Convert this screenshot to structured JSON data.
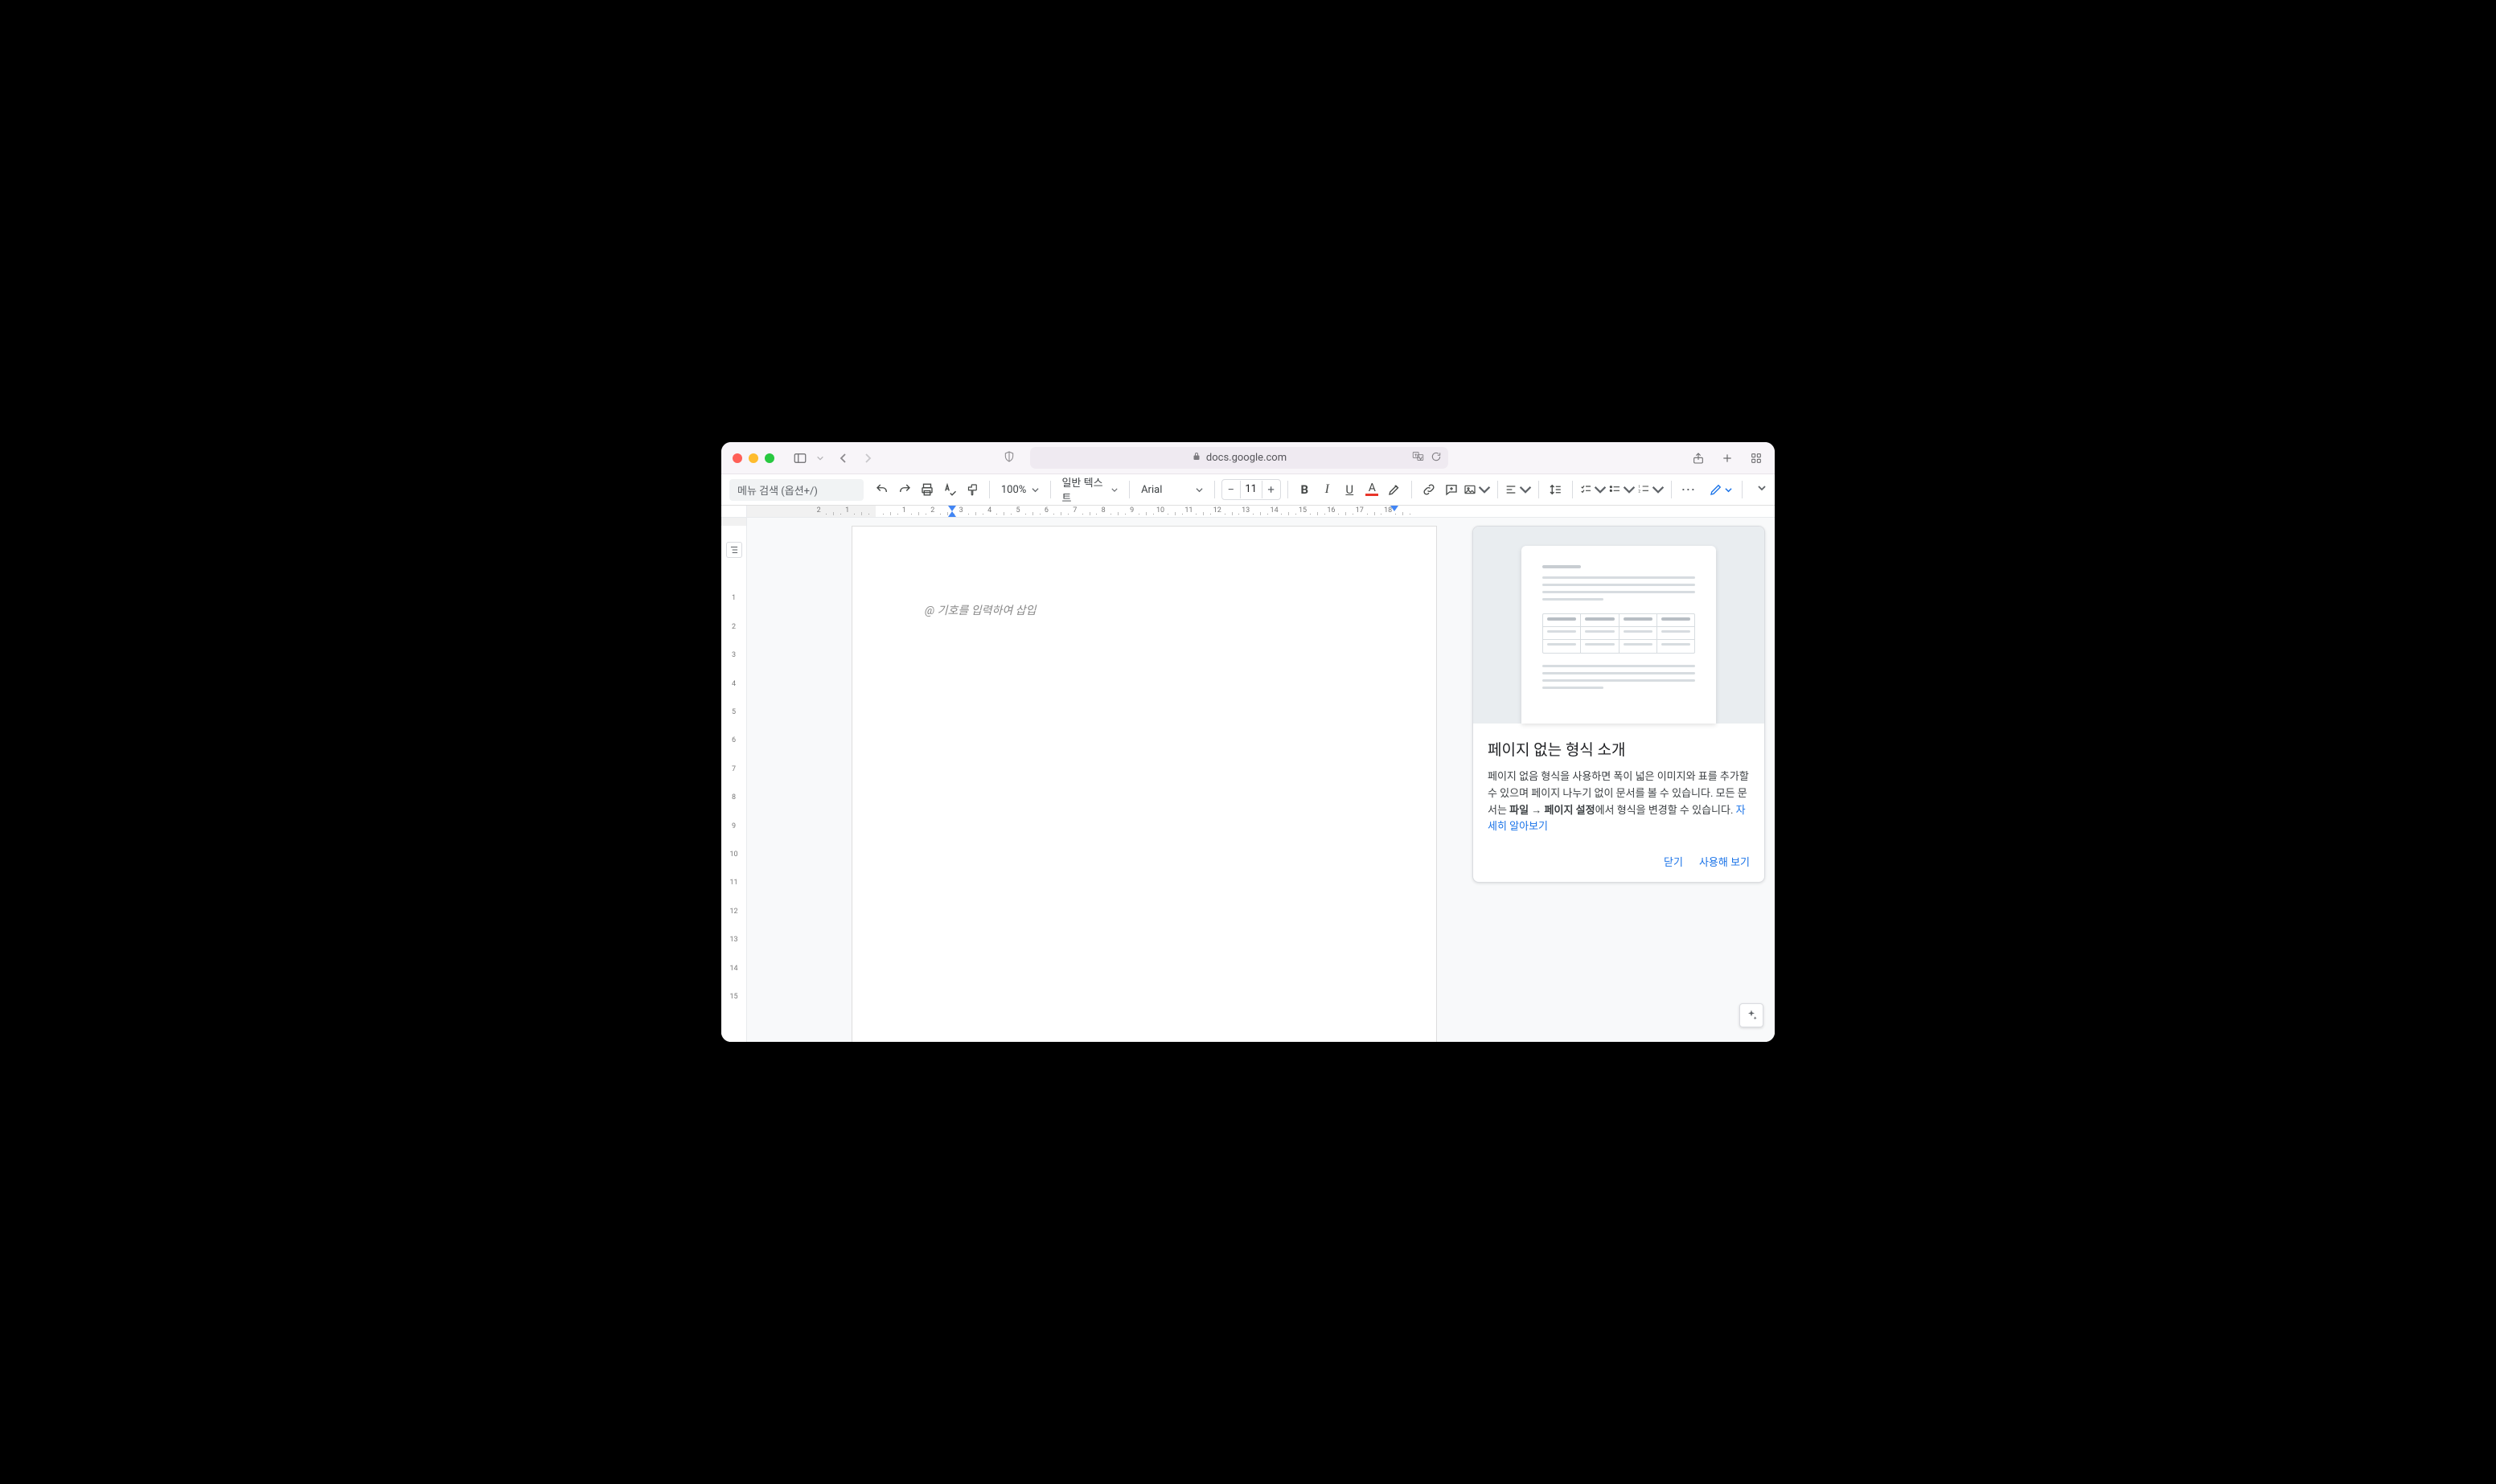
{
  "browser": {
    "url": "docs.google.com"
  },
  "toolbar": {
    "menu_search_placeholder": "메뉴 검색 (옵션+/)",
    "zoom": "100%",
    "style": "일반 텍스트",
    "font": "Arial",
    "font_size": "11",
    "minus": "−",
    "plus": "+"
  },
  "ruler": {
    "h_labels": [
      "2",
      "1",
      "1",
      "2",
      "3",
      "4",
      "5",
      "6",
      "7",
      "8",
      "9",
      "10",
      "11",
      "12",
      "13",
      "14",
      "15",
      "16",
      "17",
      "18"
    ]
  },
  "v_ruler": {
    "labels": [
      "1",
      "2",
      "3",
      "4",
      "5",
      "6",
      "7",
      "8",
      "9",
      "10",
      "11",
      "12",
      "13",
      "14",
      "15"
    ]
  },
  "document": {
    "placeholder": "@ 기호를 입력하여 삽입"
  },
  "promo": {
    "title": "페이지 없는 형식 소개",
    "text_1": "페이지 없음 형식을 사용하면 폭이 넓은 이미지와 표를 추가할 수 있으며 페이지 나누기 없이 문서를 볼 수 있습니다. 모든 문서는 ",
    "bold_1": "파일 → 페이지 설정",
    "text_2": "에서 형식을 변경할 수 있습니다. ",
    "link": "자세히 알아보기",
    "close": "닫기",
    "try": "사용해 보기"
  }
}
